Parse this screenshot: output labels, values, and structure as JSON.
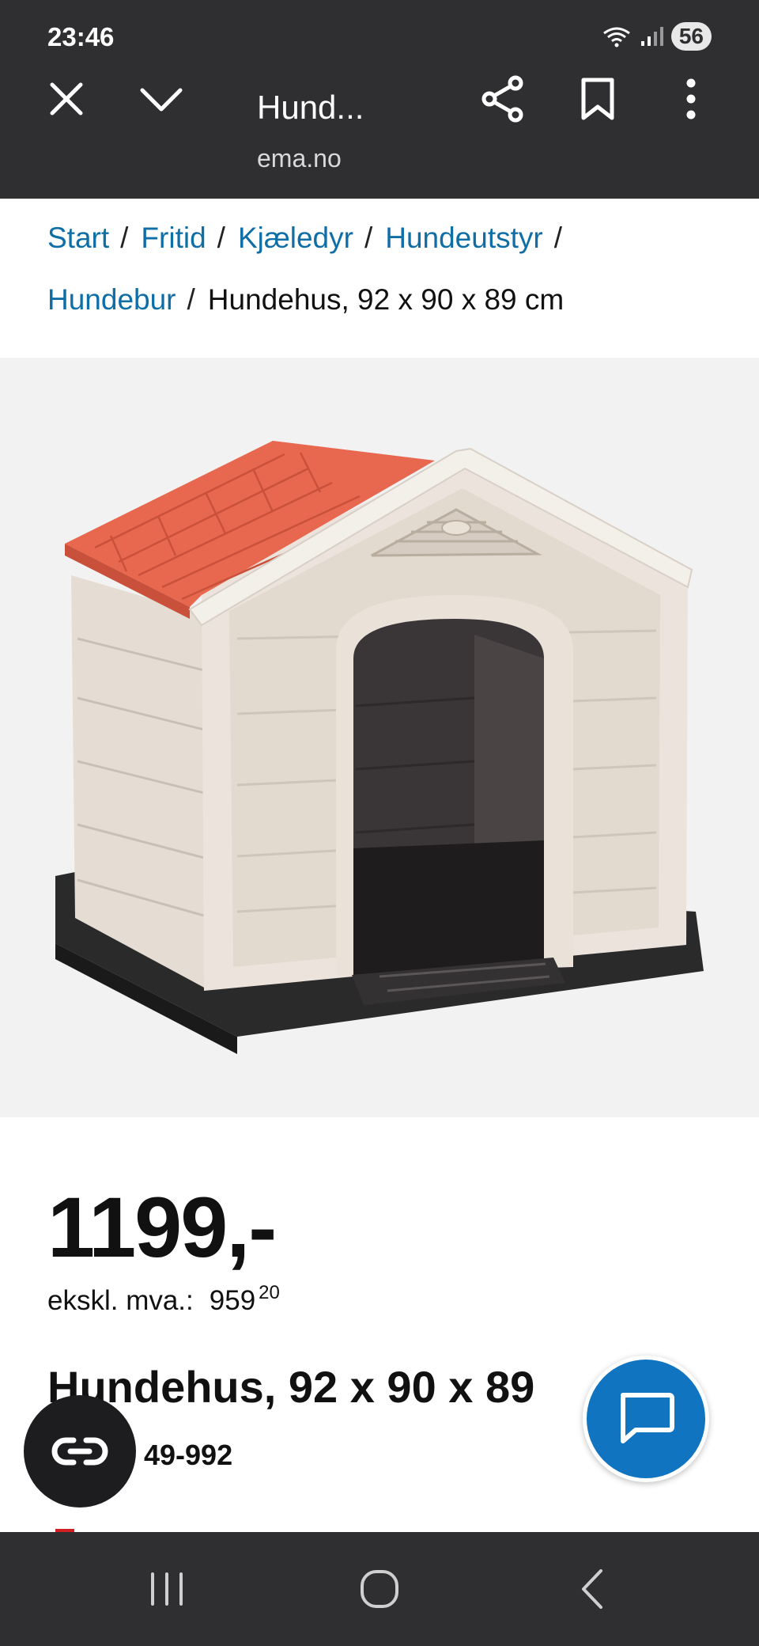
{
  "status_bar": {
    "time": "23:46",
    "battery": "56",
    "icons": [
      "wifi-icon",
      "signal-icon",
      "battery-icon"
    ]
  },
  "browser": {
    "title": "Hund...",
    "domain": "ema.no",
    "icons": [
      "close-icon",
      "chevron-down-icon",
      "share-icon",
      "bookmark-icon",
      "more-icon"
    ]
  },
  "breadcrumb": {
    "items": [
      "Start",
      "Fritid",
      "Kjæledyr",
      "Hundeutstyr",
      "Hundebur"
    ],
    "separator": "/",
    "current": "Hundehus, 92 x 90 x 89 cm"
  },
  "product": {
    "image_alt": "dog-house-image",
    "price": "1199,-",
    "ex_vat_label": "ekskl. mva.:",
    "ex_vat_whole": "959",
    "ex_vat_fraction": "20",
    "name": "Hundehus, 92 x 90 x 89",
    "sku": "49-992"
  },
  "floating": {
    "left_icon": "link-icon",
    "chat_icon": "chat-icon"
  },
  "colors": {
    "toolbar_bg": "#2f2f31",
    "link_blue": "#0f6ea6",
    "chat_blue": "#1074c0",
    "roof_red": "#e8684f"
  },
  "navbar": {
    "icons": [
      "recent-apps-icon",
      "home-icon",
      "back-icon"
    ]
  }
}
